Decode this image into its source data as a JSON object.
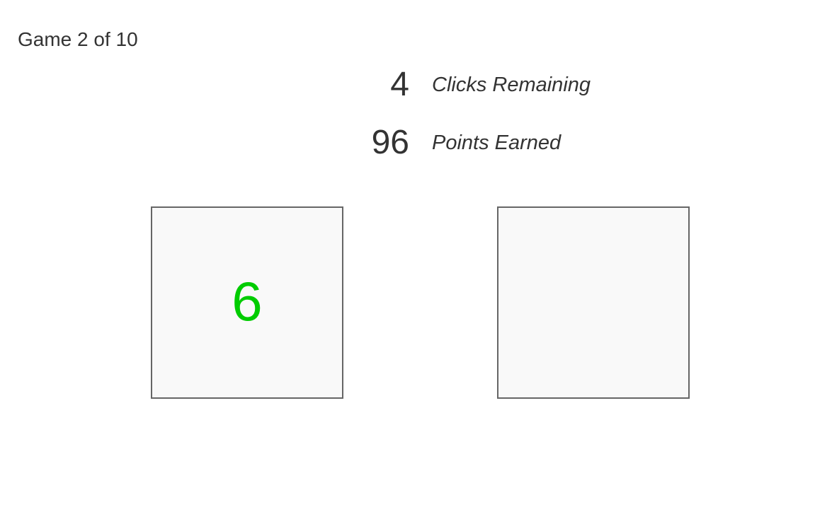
{
  "game": {
    "counter_text": "Game 2 of 10"
  },
  "stats": {
    "clicks_remaining": {
      "value": "4",
      "label": "Clicks Remaining"
    },
    "points_earned": {
      "value": "96",
      "label": "Points Earned"
    }
  },
  "boxes": [
    {
      "value": "6",
      "value_color": "#00cc00",
      "revealed": true
    },
    {
      "value": "",
      "revealed": false
    }
  ],
  "colors": {
    "box_background": "#f9f9f9",
    "box_border": "#666666",
    "text": "#333333",
    "revealed_value": "#00cc00"
  }
}
